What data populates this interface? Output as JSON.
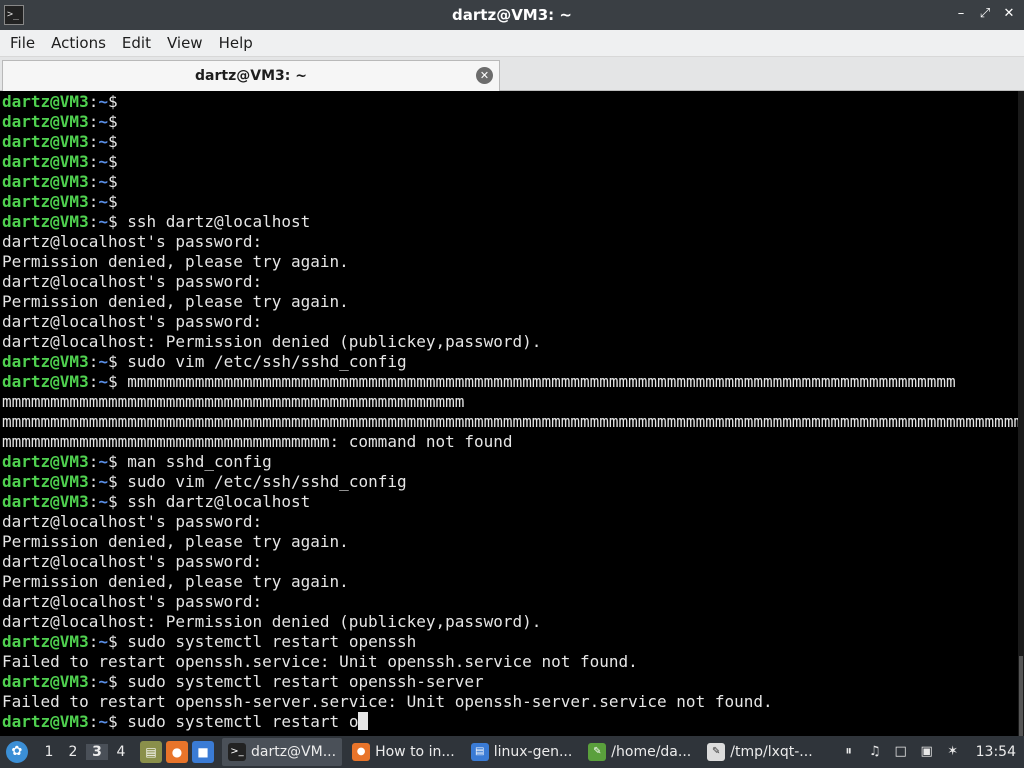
{
  "window": {
    "title": "dartz@VM3: ~",
    "app_icon": ">_",
    "controls": {
      "minimize": "–",
      "maximize": "⤢",
      "close": "✕"
    }
  },
  "menubar": {
    "items": [
      {
        "label": "File"
      },
      {
        "label": "Actions"
      },
      {
        "label": "Edit"
      },
      {
        "label": "View"
      },
      {
        "label": "Help"
      }
    ]
  },
  "tabs": [
    {
      "label": "dartz@VM3: ~",
      "close_icon": "✕"
    }
  ],
  "prompt": {
    "user": "dartz@VM3",
    "sep": ":",
    "path": "~",
    "dollar": "$"
  },
  "terminal": {
    "lines": [
      {
        "prompt": true,
        "cmd": ""
      },
      {
        "prompt": true,
        "cmd": ""
      },
      {
        "prompt": true,
        "cmd": ""
      },
      {
        "prompt": true,
        "cmd": ""
      },
      {
        "prompt": true,
        "cmd": ""
      },
      {
        "prompt": true,
        "cmd": ""
      },
      {
        "prompt": true,
        "cmd": " ssh dartz@localhost"
      },
      {
        "prompt": false,
        "text": "dartz@localhost's password:"
      },
      {
        "prompt": false,
        "text": "Permission denied, please try again."
      },
      {
        "prompt": false,
        "text": "dartz@localhost's password:"
      },
      {
        "prompt": false,
        "text": "Permission denied, please try again."
      },
      {
        "prompt": false,
        "text": "dartz@localhost's password:"
      },
      {
        "prompt": false,
        "text": "dartz@localhost: Permission denied (publickey,password)."
      },
      {
        "prompt": true,
        "cmd": " sudo vim /etc/ssh/sshd_config"
      },
      {
        "prompt": true,
        "cmd": " mmmmmmmmmmmmmmmmmmmmmmmmmmmmmmmmmmmmmmmmmmmmmmmmmmmmmmmmmmmmmmmmmmmmmmmmmmmmmmmmmmmmmm"
      },
      {
        "prompt": false,
        "text": "mmmmmmmmmmmmmmmmmmmmmmmmmmmmmmmmmmmmmmmmmmmmmmmm"
      },
      {
        "prompt": false,
        "text": "mmmmmmmmmmmmmmmmmmmmmmmmmmmmmmmmmmmmmmmmmmmmmmmmmmmmmmmmmmmmmmmmmmmmmmmmmmmmmmmmmmmmmmmmmmmmmmmmmmmmmmmmmmm"
      },
      {
        "prompt": false,
        "text": "mmmmmmmmmmmmmmmmmmmmmmmmmmmmmmmmmm: command not found"
      },
      {
        "prompt": true,
        "cmd": " man sshd_config"
      },
      {
        "prompt": true,
        "cmd": " sudo vim /etc/ssh/sshd_config"
      },
      {
        "prompt": true,
        "cmd": " ssh dartz@localhost"
      },
      {
        "prompt": false,
        "text": "dartz@localhost's password:"
      },
      {
        "prompt": false,
        "text": "Permission denied, please try again."
      },
      {
        "prompt": false,
        "text": "dartz@localhost's password:"
      },
      {
        "prompt": false,
        "text": "Permission denied, please try again."
      },
      {
        "prompt": false,
        "text": "dartz@localhost's password:"
      },
      {
        "prompt": false,
        "text": "dartz@localhost: Permission denied (publickey,password)."
      },
      {
        "prompt": true,
        "cmd": " sudo systemctl restart openssh"
      },
      {
        "prompt": false,
        "text": "Failed to restart openssh.service: Unit openssh.service not found."
      },
      {
        "prompt": true,
        "cmd": " sudo systemctl restart openssh-server"
      },
      {
        "prompt": false,
        "text": "Failed to restart openssh-server.service: Unit openssh-server.service not found."
      },
      {
        "prompt": true,
        "cmd": " sudo systemctl restart o",
        "cursor": true
      }
    ]
  },
  "taskbar": {
    "menu_icon": "✿",
    "desktops": [
      {
        "label": "1",
        "active": false
      },
      {
        "label": "2",
        "active": false
      },
      {
        "label": "3",
        "active": true
      },
      {
        "label": "4",
        "active": false
      }
    ],
    "quicklaunch": [
      {
        "name": "file-manager-icon",
        "glyph": "▤",
        "color": "#8a8f4a"
      },
      {
        "name": "firefox-icon",
        "glyph": "●",
        "color": "#e8742a"
      },
      {
        "name": "show-desktop-icon",
        "glyph": "■",
        "color": "#3a7bd5"
      }
    ],
    "tasks": [
      {
        "label": "dartz@VM...",
        "icon": "terminal-icon",
        "glyph": ">_",
        "color": "#222222",
        "active": true
      },
      {
        "label": "How to in...",
        "icon": "firefox-icon",
        "glyph": "●",
        "color": "#e8742a",
        "active": false
      },
      {
        "label": "linux-gen...",
        "icon": "folder-icon",
        "glyph": "▤",
        "color": "#3a7bd5",
        "active": false
      },
      {
        "label": "/home/da...",
        "icon": "text-editor-icon",
        "glyph": "✎",
        "color": "#5aa03c",
        "active": false
      },
      {
        "label": "/tmp/lxqt-...",
        "icon": "text-editor-icon",
        "glyph": "✎",
        "color": "#dcdcdc",
        "active": false
      }
    ],
    "tray": [
      {
        "name": "pause-icon",
        "glyph": "⏸"
      },
      {
        "name": "volume-icon",
        "glyph": "♫"
      },
      {
        "name": "clipboard-icon",
        "glyph": "□"
      },
      {
        "name": "network-icon",
        "glyph": "▣"
      },
      {
        "name": "bluetooth-icon",
        "glyph": "✶"
      }
    ],
    "clock": "13:54"
  }
}
